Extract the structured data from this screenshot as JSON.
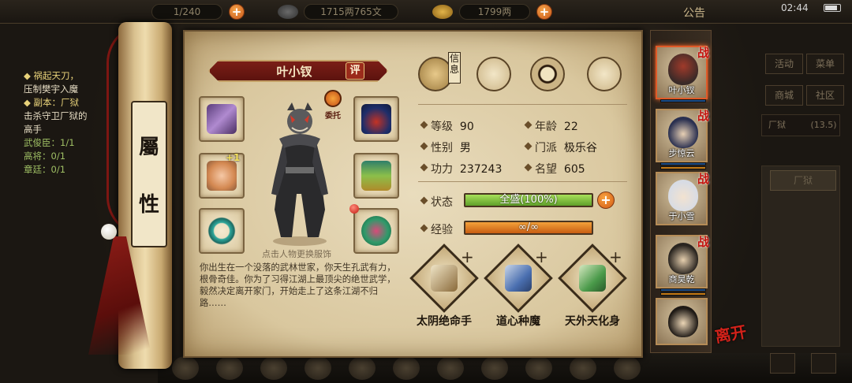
{
  "topbar": {
    "slots_value": "1/240",
    "money_value": "1715两765文",
    "yuanbao_value": "1799两",
    "announce_label": "公告",
    "clock": "02:44"
  },
  "quest": {
    "line1": "◆ 祸起天刀，",
    "line2": "压制樊宇入魔",
    "line3": "◆ 副本：厂狱",
    "line4": "击杀守卫厂狱的",
    "line5": "高手",
    "line6": "武俊臣：1/1",
    "line7": "高将：0/1",
    "line8": "章廷：0/1"
  },
  "scroll": {
    "char1": "屬",
    "char2": "性"
  },
  "character": {
    "name": "叶小钗",
    "rate_label": "评",
    "trust_label": "委托",
    "equip_plus": "+1",
    "tap_hint": "点击人物更换服饰",
    "bio": "你出生在一个没落的武林世家，你天生孔武有力，根骨奇佳。你为了习得江湖上最顶尖的绝世武学，毅然决定离开家门，开始走上了这条江湖不归路……"
  },
  "tabs": {
    "info_tag": "信息",
    "icons": [
      "straw-hat-icon",
      "map-scroll-icon",
      "bagua-icon",
      "meridian-body-icon"
    ]
  },
  "stats": {
    "level_label": "等级",
    "level_value": "90",
    "age_label": "年龄",
    "age_value": "22",
    "gender_label": "性别",
    "gender_value": "男",
    "sect_label": "门派",
    "sect_value": "极乐谷",
    "power_label": "功力",
    "power_value": "237243",
    "fame_label": "名望",
    "fame_value": "605",
    "status_label": "状态",
    "status_value": "全盛(100%)",
    "status_fraction": 1.0,
    "exp_label": "经验",
    "exp_value": "∞/∞"
  },
  "skills": [
    {
      "name": "太阴绝命手",
      "icon": "book-icon"
    },
    {
      "name": "道心种魔",
      "icon": "blue-scroll-icon"
    },
    {
      "name": "天外天化身",
      "icon": "green-scroll-icon"
    }
  ],
  "party": {
    "war_label": "战",
    "members": [
      {
        "name": "叶小钗"
      },
      {
        "name": "步惊云"
      },
      {
        "name": "于小雪"
      },
      {
        "name": "商昊乾"
      },
      {
        "name": ""
      }
    ],
    "leave_label": "离开"
  },
  "right_menu": {
    "activity": "活动",
    "menu": "菜单",
    "shop": "商城",
    "community": "社区",
    "location": "厂狱",
    "location_count": "(13.5)",
    "box_label": "厂狱"
  },
  "colors": {
    "parchment": "#e3d3ae",
    "banner_red": "#6b1812",
    "status_green": "#7bc33a",
    "exp_orange": "#e07a1a",
    "accent_orange": "#e8762a"
  }
}
